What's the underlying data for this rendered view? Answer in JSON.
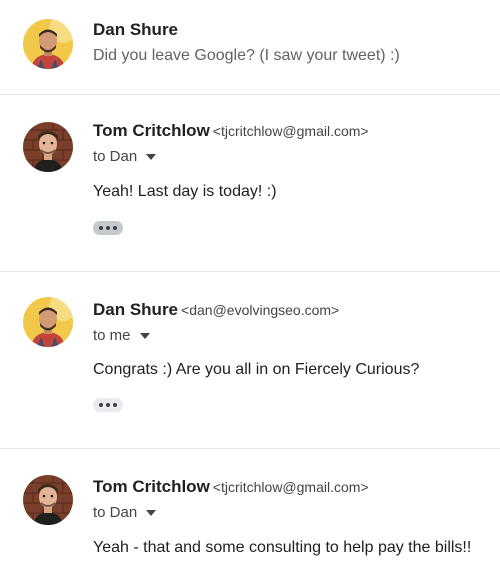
{
  "messages": [
    {
      "sender": "Dan Shure",
      "snippet": "Did you leave Google? (I saw your tweet) :)"
    },
    {
      "sender": "Tom Critchlow",
      "email": "<tjcritchlow@gmail.com>",
      "recipients": "to Dan",
      "body": "Yeah! Last day is today! :)"
    },
    {
      "sender": "Dan Shure",
      "email": "<dan@evolvingseo.com>",
      "recipients": "to me",
      "body": "Congrats :) Are you all in on Fiercely Curious?"
    },
    {
      "sender": "Tom Critchlow",
      "email": "<tjcritchlow@gmail.com>",
      "recipients": "to Dan",
      "body": "Yeah - that and some consulting to help pay the bills!!"
    }
  ],
  "icons": {
    "caret": "chevron-down-icon",
    "more": "more-horiz-icon"
  },
  "colors": {
    "divider": "#e8e8e8",
    "dan_avatar_bg": "#f2c84b",
    "tom_avatar_bg": "#7a3f2a",
    "trim_button_bg": "#e8eaed"
  }
}
